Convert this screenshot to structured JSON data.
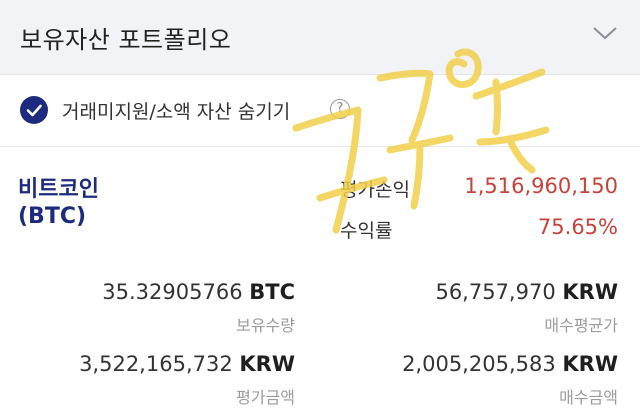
{
  "header": {
    "title": "보유자산 포트폴리오",
    "toggle_icon": "chevron-down-icon"
  },
  "filter": {
    "checked": true,
    "label": "거래미지원/소액 자산 숨기기",
    "help_icon": "question-circle-icon",
    "help_glyph": "?"
  },
  "asset": {
    "name": "비트코인",
    "ticker": "(BTC)",
    "profit_label": "평가손익",
    "profit_value": "1,516,960,150",
    "return_label": "수익률",
    "return_value": "75.65%",
    "holdings_amount": "35.32905766",
    "holdings_unit": "BTC",
    "holdings_caption": "보유수량",
    "avg_price": "56,757,970",
    "avg_price_unit": "KRW",
    "avg_price_caption": "매수평균가",
    "valuation": "3,522,165,732",
    "valuation_unit": "KRW",
    "valuation_caption": "평가금액",
    "purchase": "2,005,205,583",
    "purchase_unit": "KRW",
    "purchase_caption": "매수금액"
  },
  "colors": {
    "accent": "#1c2b80",
    "profit": "#c8423a",
    "header_bg": "#f2f3f6",
    "caption": "#9b9b9b",
    "handwriting": "#f1cf4a"
  }
}
